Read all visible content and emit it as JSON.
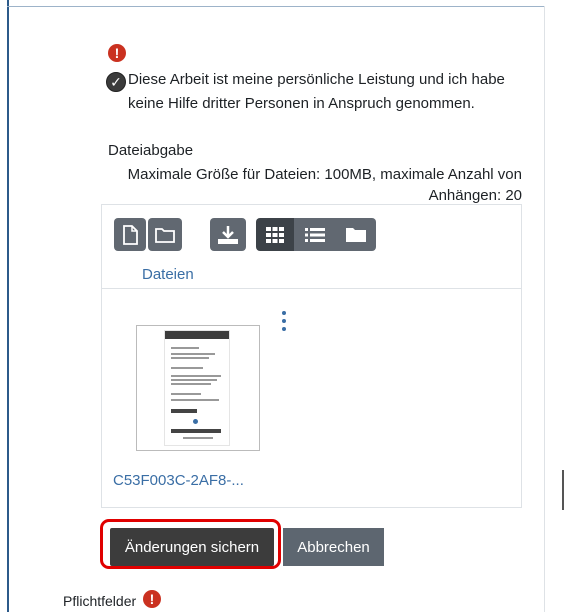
{
  "declaration": {
    "text": "Diese Arbeit ist meine persönliche Leistung und ich habe keine Hilfe dritter Personen in Anspruch genommen.",
    "checked": true,
    "icon": "exclamation-circle-icon"
  },
  "submission": {
    "label": "Dateiabgabe",
    "limits": "Maximale Größe für Dateien: 100MB, maximale Anzahl von Anhängen: 20"
  },
  "filepicker": {
    "toolbar_icons": [
      "add-file-icon",
      "create-folder-icon",
      "download-icon",
      "grid-view-icon",
      "list-view-icon",
      "folder-view-icon"
    ],
    "breadcrumb": "Dateien",
    "files": [
      {
        "name": "C53F003C-2AF8-..."
      }
    ]
  },
  "buttons": {
    "save": "Änderungen sichern",
    "cancel": "Abbrechen"
  },
  "required_note": "Pflichtfelder",
  "colors": {
    "alert": "#ca3120",
    "link": "#3a6ea5",
    "highlight": "#e00000",
    "button_dark": "#3c3c3c",
    "button_secondary": "#5d6670"
  }
}
